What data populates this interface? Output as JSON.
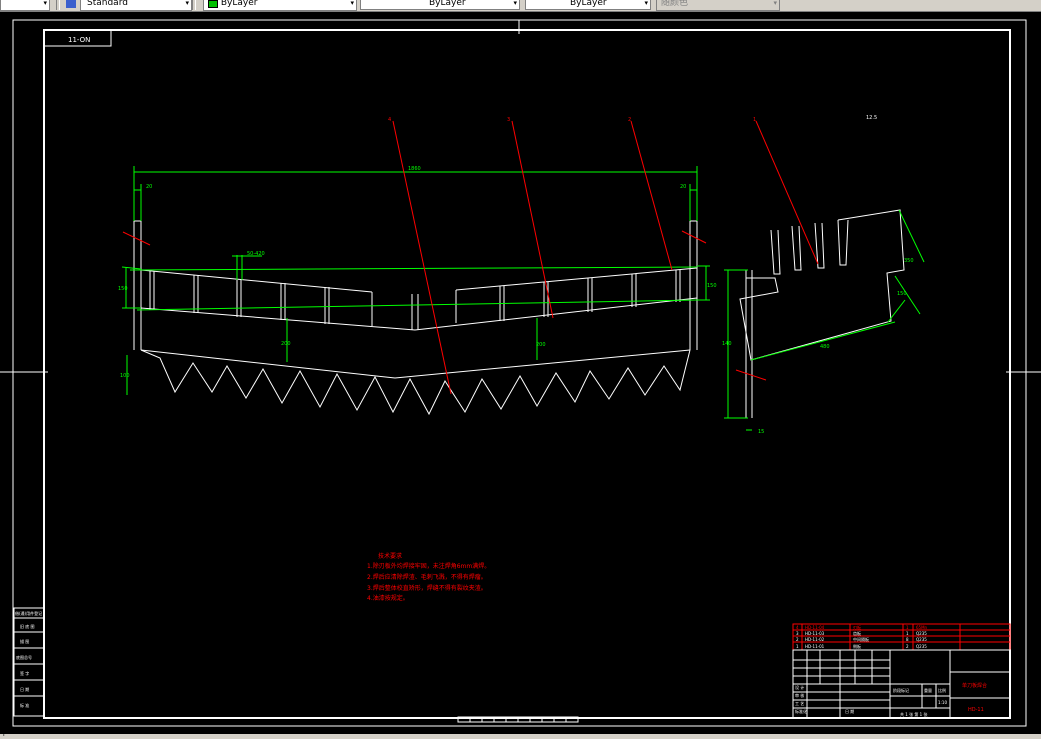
{
  "toolbar": {
    "text_style": "Standard",
    "color_control": "ByLayer",
    "linetype_control": "ByLayer",
    "lineweight_control": "ByLayer",
    "plot_style": "随颜色"
  },
  "drawing": {
    "corner_tag": "11-ON",
    "overall_width": "1860",
    "dim_left_small": "20",
    "dim_right_small": "20",
    "dim_bar_spacing": "50-420",
    "dim_left_height": "150",
    "dim_right_height": "150",
    "dim_center_left": "200",
    "dim_center_right": "200",
    "dim_tooth": "100",
    "dim_side_top": "350",
    "dim_side_mid": "150",
    "dim_side_bottom": "480",
    "dim_side_height": "140",
    "dim_side_foot": "15",
    "roughness": "12.5",
    "callouts": [
      "4",
      "3",
      "2",
      "1"
    ],
    "notes_title": "技术要求",
    "notes": [
      "1.除刃板外均焊接牢固，未注焊角6mm满焊。",
      "2.焊后应清除焊渣、毛刺飞溅，不得有焊瘤。",
      "3.焊后整体校直矫形，焊缝不得有裂纹夹渣。",
      "4.油漆按规定。"
    ]
  },
  "left_block": [
    "借(通)用件登记",
    "旧 底 图",
    "描 图",
    "底图总号",
    "签 字",
    "日 期",
    "标 准"
  ],
  "title_block": {
    "parts": [
      {
        "no": "4",
        "code": "HD-11-04",
        "name": "刃板",
        "qty": "1",
        "material": "65Mn"
      },
      {
        "no": "3",
        "code": "HD-11-03",
        "name": "齿板",
        "qty": "1",
        "material": "Q235"
      },
      {
        "no": "2",
        "code": "HD-11-02",
        "name": "中间隔板",
        "qty": "8",
        "material": "Q235"
      },
      {
        "no": "1",
        "code": "HD-11-01",
        "name": "侧板",
        "qty": "2",
        "material": "Q235"
      }
    ],
    "drawing_name": "单刀板焊合",
    "drawing_no": "HD-11",
    "stage_label": "阶段标记",
    "weight_label": "重量",
    "scale_label": "比例",
    "scale": "1:10",
    "sheet_info": "共 1 张  第 1 张",
    "row_labels": [
      "设 计",
      "审 核",
      "工 艺",
      "标准化",
      "日 期"
    ]
  },
  "status": {
    "cursor": "Y"
  }
}
